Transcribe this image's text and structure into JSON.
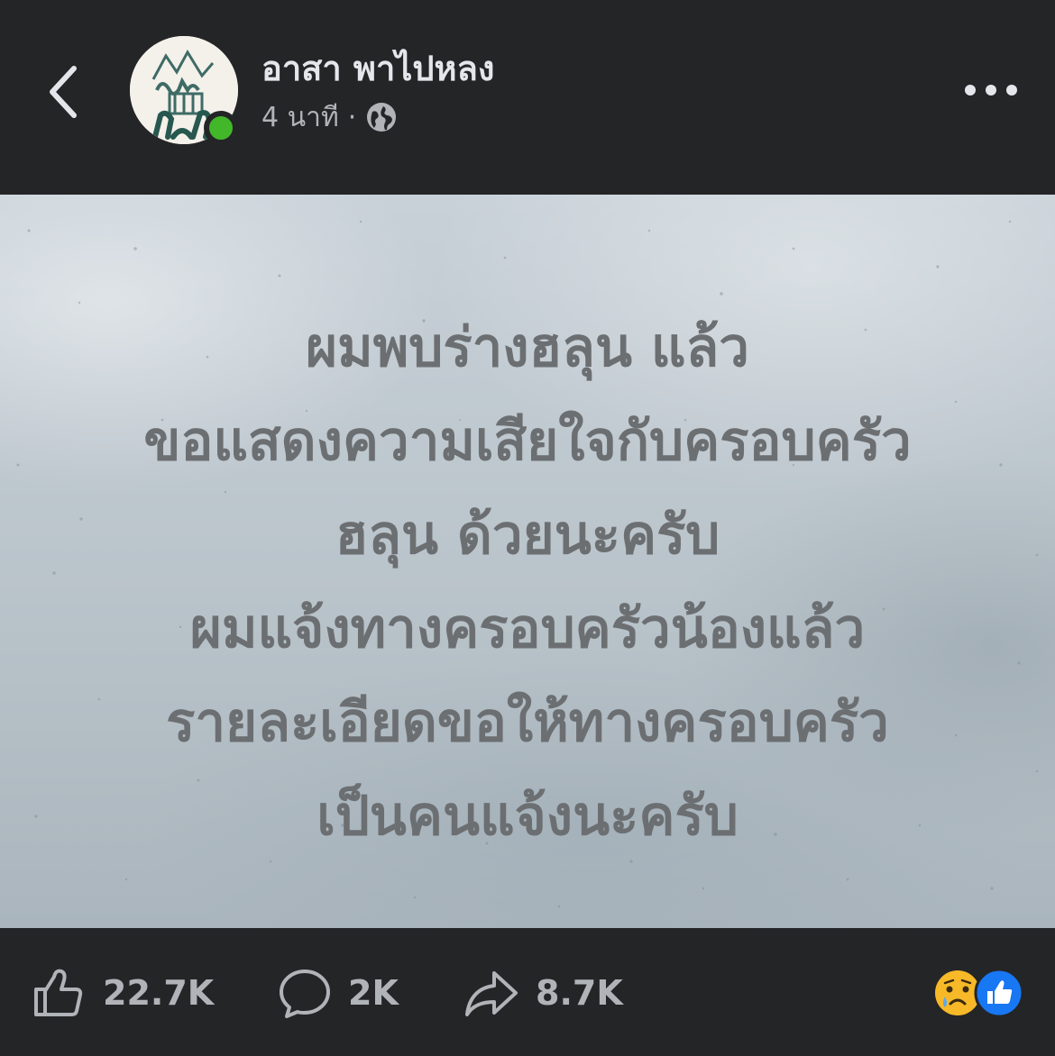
{
  "header": {
    "page_name": "อาสา พาไปหลง",
    "time_ago": "4 นาที",
    "separator": "·",
    "privacy_icon": "globe-icon",
    "back_icon": "chevron-left-icon",
    "more_icon": "more-dots-icon",
    "avatar_text": "อาสา พาไปหลง",
    "online_color": "#42b72a"
  },
  "post": {
    "lines": [
      "ผมพบร่างฮลุน แล้ว",
      "ขอแสดงความเสียใจกับครอบครัว",
      "ฮลุน ด้วยนะครับ",
      "ผมแจ้งทางครอบครัวน้องแล้ว",
      "รายละเอียดขอให้ทางครอบครัว",
      "เป็นคนแจ้งนะครับ"
    ],
    "text_color": "#6c6f72"
  },
  "footer": {
    "like_count": "22.7K",
    "comment_count": "2K",
    "share_count": "8.7K",
    "like_icon": "thumbs-up-icon",
    "comment_icon": "comment-bubble-icon",
    "share_icon": "share-arrow-icon",
    "reaction_icons": [
      "sad-reaction-icon",
      "like-reaction-icon"
    ]
  },
  "colors": {
    "background": "#242527",
    "primary_text": "#e4e6eb",
    "secondary_text": "#b0b3b8",
    "like_blue": "#1877f2",
    "sad_yellow": "#f7b928"
  }
}
